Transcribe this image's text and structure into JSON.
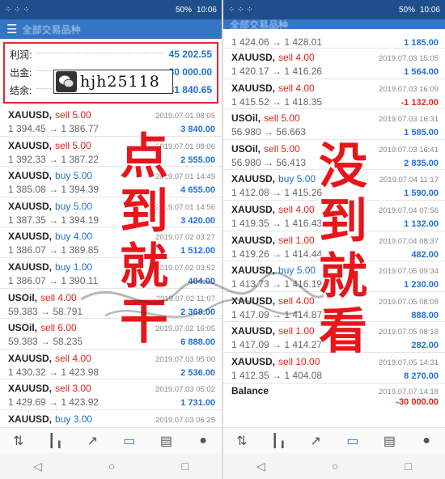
{
  "status": {
    "signal": "⁘ ⁘ ⁘",
    "battery": "50%",
    "time": "10:06"
  },
  "appbar": {
    "title": "全部交易品种"
  },
  "summary": {
    "profit_label": "利润:",
    "profit_value": "45 202.55",
    "withdraw_label": "出金:",
    "withdraw_value": "30 000.00",
    "balance_label": "结余:",
    "balance_value": "81 840.65"
  },
  "wechat_id": "hjh25118",
  "overlay": {
    "left": [
      "点",
      "到",
      "就",
      "干"
    ],
    "right": [
      "没",
      "到",
      "就",
      "看"
    ]
  },
  "left_trades": [
    {
      "symbol": "XAUUSD,",
      "side": "sell 5.00",
      "type": "sell",
      "prices": "1 394.45 → 1 386.77",
      "date": "2019.07.01 08:05",
      "profit": "3 840.00"
    },
    {
      "symbol": "XAUUSD,",
      "side": "sell 5.00",
      "type": "sell",
      "prices": "1 392.33 → 1 387.22",
      "date": "2019.07.01 08:06",
      "profit": "2 555.00"
    },
    {
      "symbol": "XAUUSD,",
      "side": "buy 5.00",
      "type": "buy",
      "prices": "1 385.08 → 1 394.39",
      "date": "2019.07.01 14:49",
      "profit": "4 655.00"
    },
    {
      "symbol": "XAUUSD,",
      "side": "buy 5.00",
      "type": "buy",
      "prices": "1 387.35 → 1 394.19",
      "date": "2019.07.01 14:56",
      "profit": "3 420.00"
    },
    {
      "symbol": "XAUUSD,",
      "side": "buy 4.00",
      "type": "buy",
      "prices": "1 386.07 → 1 389.85",
      "date": "2019.07.02 03:27",
      "profit": "1 512.00"
    },
    {
      "symbol": "XAUUSD,",
      "side": "buy 1.00",
      "type": "buy",
      "prices": "1 386.07 → 1 390.11",
      "date": "2019.07.02 03:52",
      "profit": "404.00"
    },
    {
      "symbol": "USOil,",
      "side": "sell 4.00",
      "type": "sell",
      "prices": "59.383 → 58.791",
      "date": "2019.07.02 11:07",
      "profit": "2 368.00"
    },
    {
      "symbol": "USOil,",
      "side": "sell 6.00",
      "type": "sell",
      "prices": "59.383 → 58.235",
      "date": "2019.07.02 16:05",
      "profit": "6 888.00"
    },
    {
      "symbol": "XAUUSD,",
      "side": "sell 4.00",
      "type": "sell",
      "prices": "1 430.32 → 1 423.98",
      "date": "2019.07.03 05:00",
      "profit": "2 536.00"
    },
    {
      "symbol": "XAUUSD,",
      "side": "sell 3.00",
      "type": "sell",
      "prices": "1 429.69 → 1 423.92",
      "date": "2019.07.03 05:02",
      "profit": "1 731.00"
    },
    {
      "symbol": "XAUUSD,",
      "side": "buy 3.00",
      "type": "buy",
      "prices": "",
      "date": "2019.07.03 06:25",
      "profit": ""
    }
  ],
  "right_partial": {
    "prices": "1 424.06 → 1 428.01",
    "profit": "1 185.00"
  },
  "right_trades": [
    {
      "symbol": "XAUUSD,",
      "side": "sell 4.00",
      "type": "sell",
      "prices": "1 420.17 → 1 416.26",
      "date": "2019.07.03 15:05",
      "profit": "1 564.00"
    },
    {
      "symbol": "XAUUSD,",
      "side": "sell 4.00",
      "type": "sell",
      "prices": "1 415.52 → 1 418.35",
      "date": "2019.07.03 16:09",
      "profit": "-1 132.00"
    },
    {
      "symbol": "USOil,",
      "side": "sell 5.00",
      "type": "sell",
      "prices": "56.980 → 56.663",
      "date": "2019.07.03 16:31",
      "profit": "1 585.00"
    },
    {
      "symbol": "USOil,",
      "side": "sell 5.00",
      "type": "sell",
      "prices": "56.980 → 56.413",
      "date": "2019.07.03 16:41",
      "profit": "2 835.00"
    },
    {
      "symbol": "XAUUSD,",
      "side": "buy 5.00",
      "type": "buy",
      "prices": "1 412.08 → 1 415.26",
      "date": "2019.07.04 11:17",
      "profit": "1 590.00"
    },
    {
      "symbol": "XAUUSD,",
      "side": "sell 4.00",
      "type": "sell",
      "prices": "1 419.35 → 1 416.43",
      "date": "2019.07.04 07:56",
      "profit": "1 132.00"
    },
    {
      "symbol": "XAUUSD,",
      "side": "sell 1.00",
      "type": "sell",
      "prices": "1 419.26 → 1 414.44",
      "date": "2019.07.04 08:37",
      "profit": "482.00"
    },
    {
      "symbol": "XAUUSD,",
      "side": "buy 5.00",
      "type": "buy",
      "prices": "1 413.73 → 1 416.19",
      "date": "2019.07.05 09:34",
      "profit": "1 230.00"
    },
    {
      "symbol": "XAUUSD,",
      "side": "sell 4.00",
      "type": "sell",
      "prices": "1 417.09 → 1 414.87",
      "date": "2019.07.05 08:08",
      "profit": "888.00"
    },
    {
      "symbol": "XAUUSD,",
      "side": "sell 1.00",
      "type": "sell",
      "prices": "1 417.09 → 1 414.27",
      "date": "2019.07.05 08:18",
      "profit": "282.00"
    },
    {
      "symbol": "XAUUSD,",
      "side": "sell 10.00",
      "type": "sell",
      "prices": "1 412.35 → 1 404.08",
      "date": "2019.07.05 14:31",
      "profit": "8 270.00"
    }
  ],
  "balance_row": {
    "label": "Balance",
    "date": "2019.07.07 14:18",
    "profit": "-30 000.00"
  },
  "colors": {
    "buy": "#1f6fd6",
    "sell": "#e0251b",
    "accent": "#3576c4",
    "overlay": "#e8151b"
  },
  "nav_icons": [
    "quotes-icon",
    "chart-icon",
    "trade-icon",
    "history-icon",
    "news-icon",
    "chat-icon"
  ]
}
